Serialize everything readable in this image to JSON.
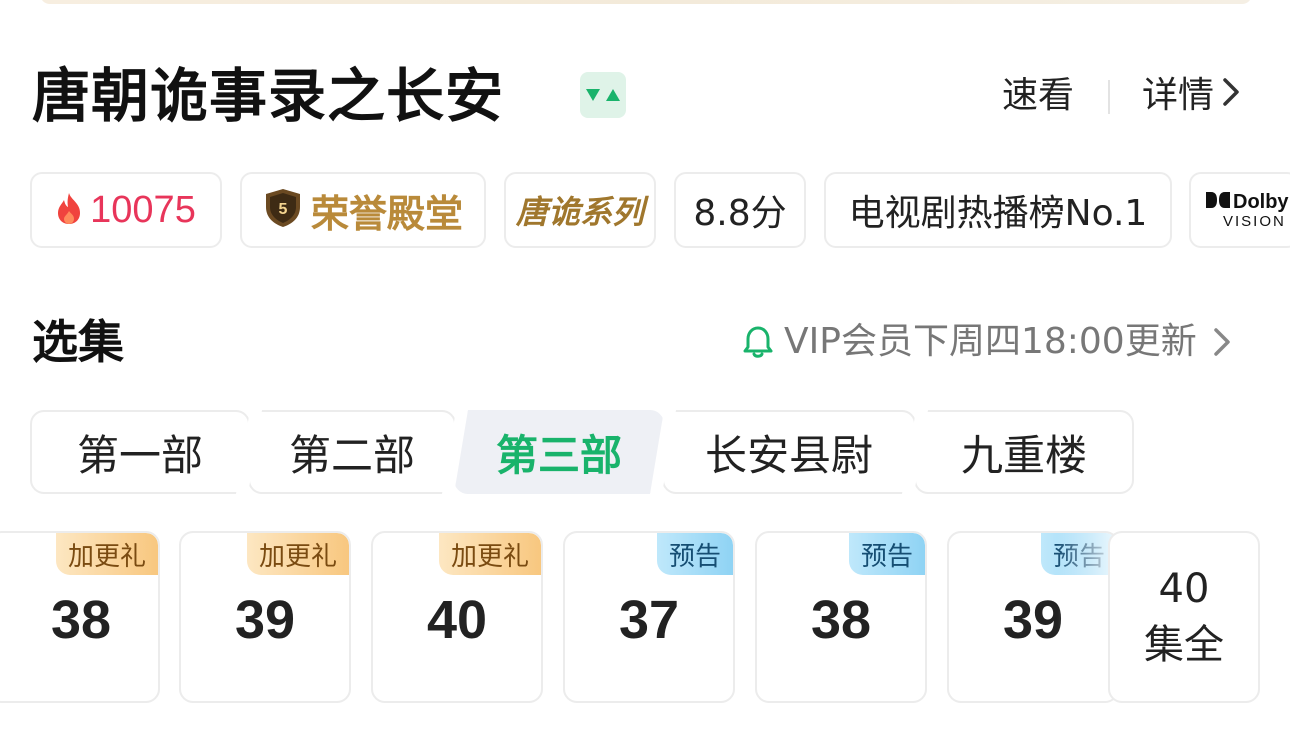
{
  "title": "唐朝诡事录之长安",
  "header_actions": {
    "quick_view": "速看",
    "detail": "详情"
  },
  "tags": {
    "heat": "10075",
    "honor": "荣誉殿堂",
    "honor_level": "5",
    "series": "唐诡系列",
    "score": "8.8分",
    "rank": "电视剧热播榜No.1",
    "dolby_top": "Dolby",
    "dolby_bottom": "VISION"
  },
  "episodes_section": {
    "title": "选集",
    "update_info": "VIP会员下周四18:00更新"
  },
  "season_tabs": [
    {
      "label": "第一部",
      "active": false
    },
    {
      "label": "第二部",
      "active": false
    },
    {
      "label": "第三部",
      "active": true
    },
    {
      "label": "长安县尉",
      "active": false
    },
    {
      "label": "九重楼",
      "active": false
    }
  ],
  "episodes": [
    {
      "num": "38",
      "badge": "加更礼"
    },
    {
      "num": "39",
      "badge": "加更礼"
    },
    {
      "num": "40",
      "badge": "加更礼"
    },
    {
      "num": "37",
      "badge": "预告"
    },
    {
      "num": "38",
      "badge": "预告"
    },
    {
      "num": "39",
      "badge": "预告"
    }
  ],
  "all_episodes": {
    "count": "40",
    "label": "集全"
  },
  "colors": {
    "accent_green": "#19b36b",
    "heat_red": "#e8355a",
    "honor_gold": "#b98a3a"
  }
}
